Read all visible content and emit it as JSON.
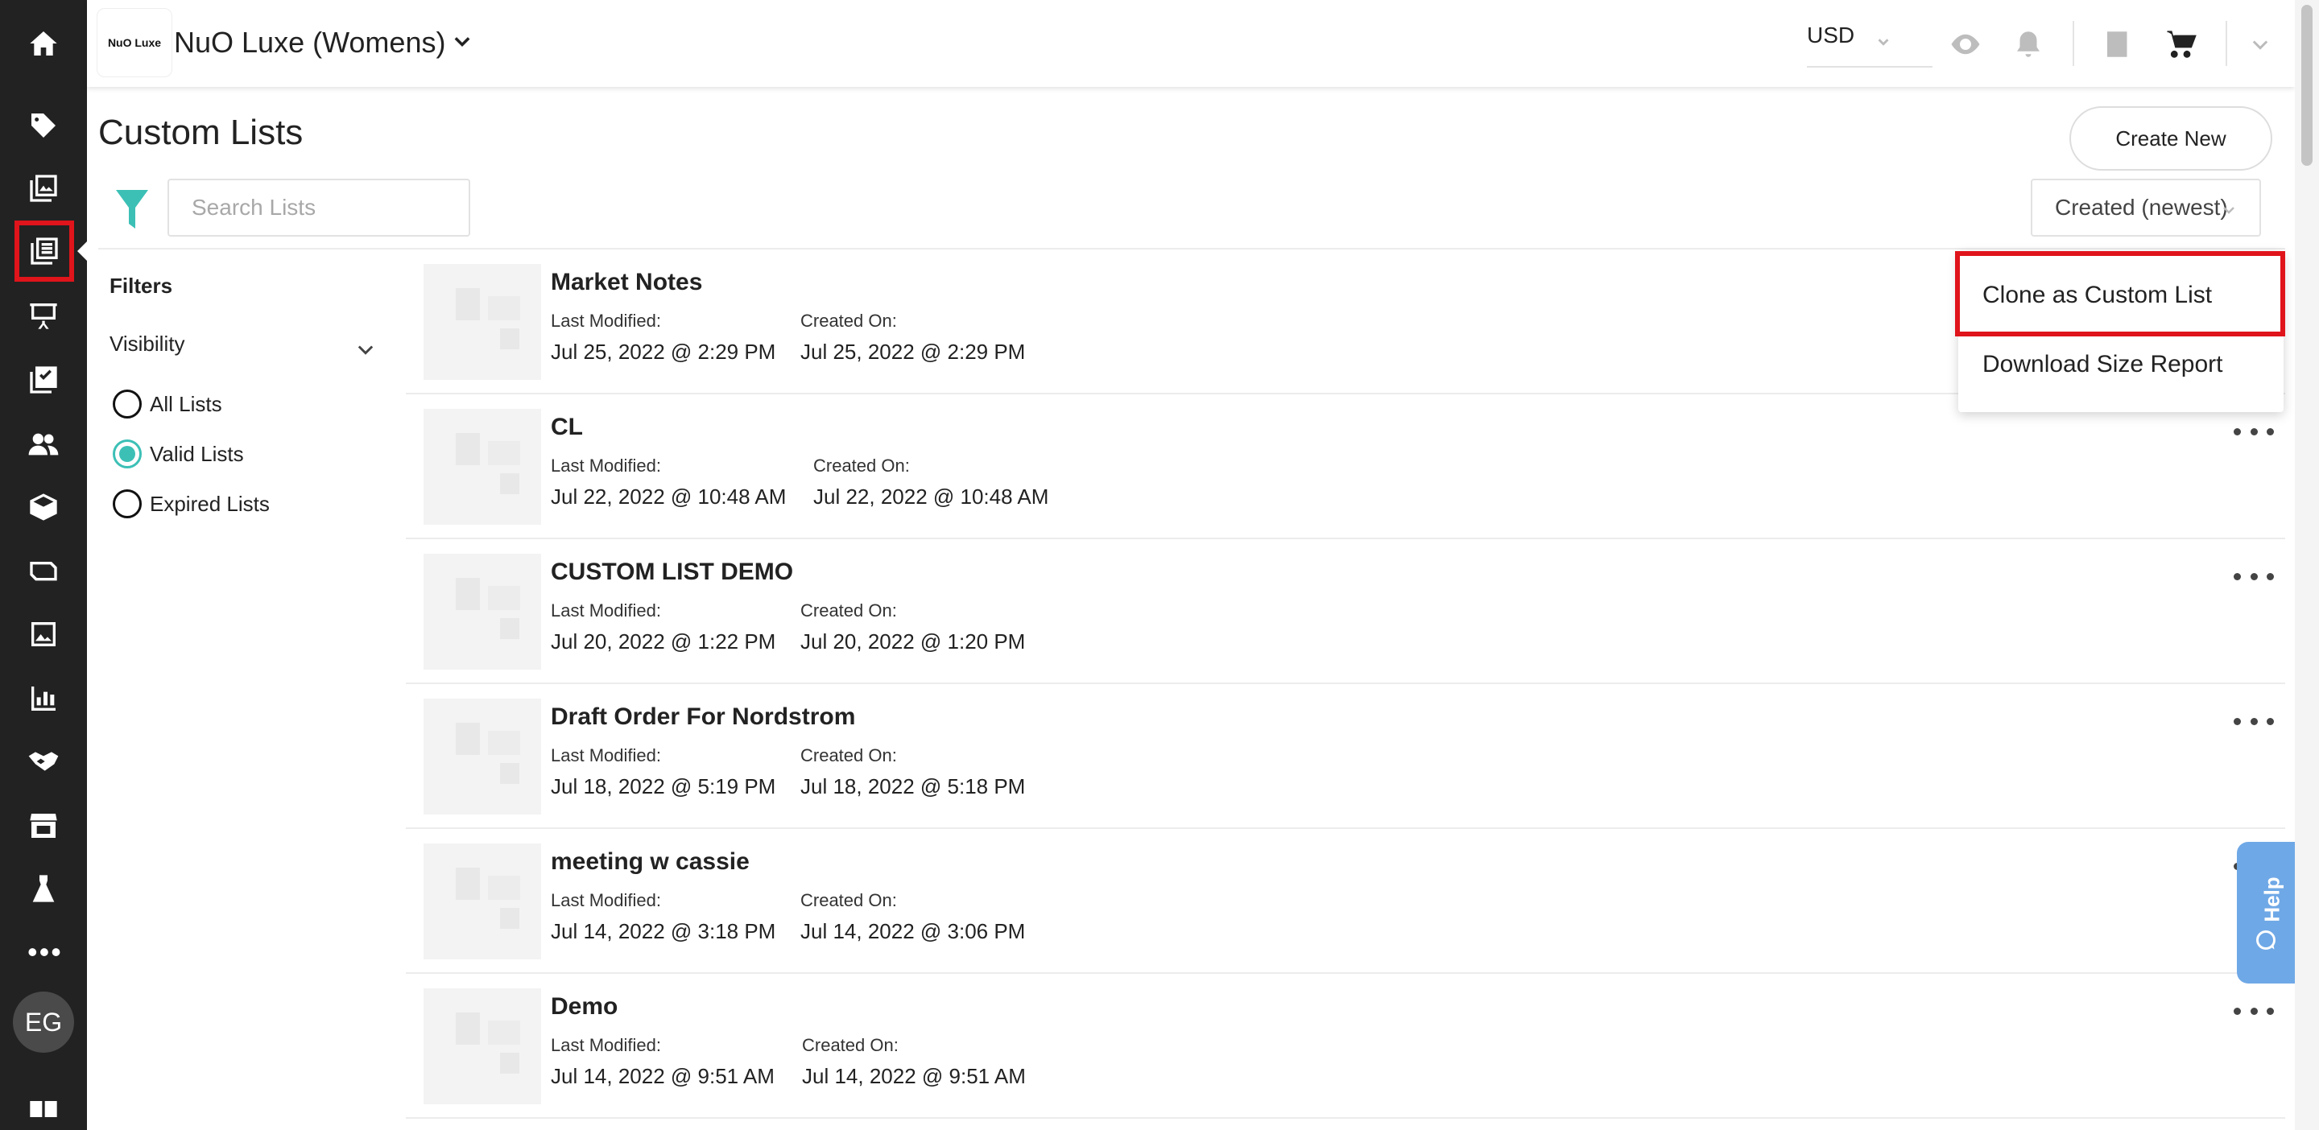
{
  "header": {
    "brand_logo_text": "NuO Luxe",
    "brand_name": "NuO Luxe (Womens)",
    "currency": "USD"
  },
  "page": {
    "title": "Custom Lists",
    "create_new_label": "Create New",
    "search_placeholder": "Search Lists",
    "sort_selected": "Created (newest)"
  },
  "filters": {
    "title": "Filters",
    "visibility_label": "Visibility",
    "options": [
      {
        "label": "All Lists",
        "checked": false
      },
      {
        "label": "Valid Lists",
        "checked": true
      },
      {
        "label": "Expired Lists",
        "checked": false
      }
    ]
  },
  "list_labels": {
    "last_modified": "Last Modified:",
    "created_on": "Created On:"
  },
  "lists": [
    {
      "name": "Market Notes",
      "last_modified": "Jul 25, 2022 @ 2:29 PM",
      "created_on": "Jul 25, 2022 @ 2:29 PM"
    },
    {
      "name": "CL",
      "last_modified": "Jul 22, 2022 @ 10:48 AM",
      "created_on": "Jul 22, 2022 @ 10:48 AM"
    },
    {
      "name": "CUSTOM LIST DEMO",
      "last_modified": "Jul 20, 2022 @ 1:22 PM",
      "created_on": "Jul 20, 2022 @ 1:20 PM"
    },
    {
      "name": "Draft Order For Nordstrom",
      "last_modified": "Jul 18, 2022 @ 5:19 PM",
      "created_on": "Jul 18, 2022 @ 5:18 PM"
    },
    {
      "name": "meeting w cassie",
      "last_modified": "Jul 14, 2022 @ 3:18 PM",
      "created_on": "Jul 14, 2022 @ 3:06 PM"
    },
    {
      "name": "Demo",
      "last_modified": "Jul 14, 2022 @ 9:51 AM",
      "created_on": "Jul 14, 2022 @ 9:51 AM"
    }
  ],
  "menu": {
    "items": [
      {
        "label": "Clone as Custom List",
        "highlighted": true
      },
      {
        "label": "Download Size Report",
        "highlighted": false
      }
    ]
  },
  "sidebar": {
    "icons": [
      "home-icon",
      "tag-icon",
      "gallery-icon",
      "list-icon",
      "presentation-icon",
      "checklist-icon",
      "users-icon",
      "box-icon",
      "envelope-icon",
      "image-icon",
      "bar-chart-icon",
      "handshake-icon",
      "storefront-icon",
      "dress-icon",
      "more-icon"
    ],
    "active": "list-icon",
    "avatar_initials": "EG"
  },
  "help": {
    "label": "Help"
  },
  "colors": {
    "sidebar_bg": "#222222",
    "accent_teal": "#3cc0b6",
    "highlight_red": "#e0141b",
    "help_blue": "#6fa8e6"
  }
}
